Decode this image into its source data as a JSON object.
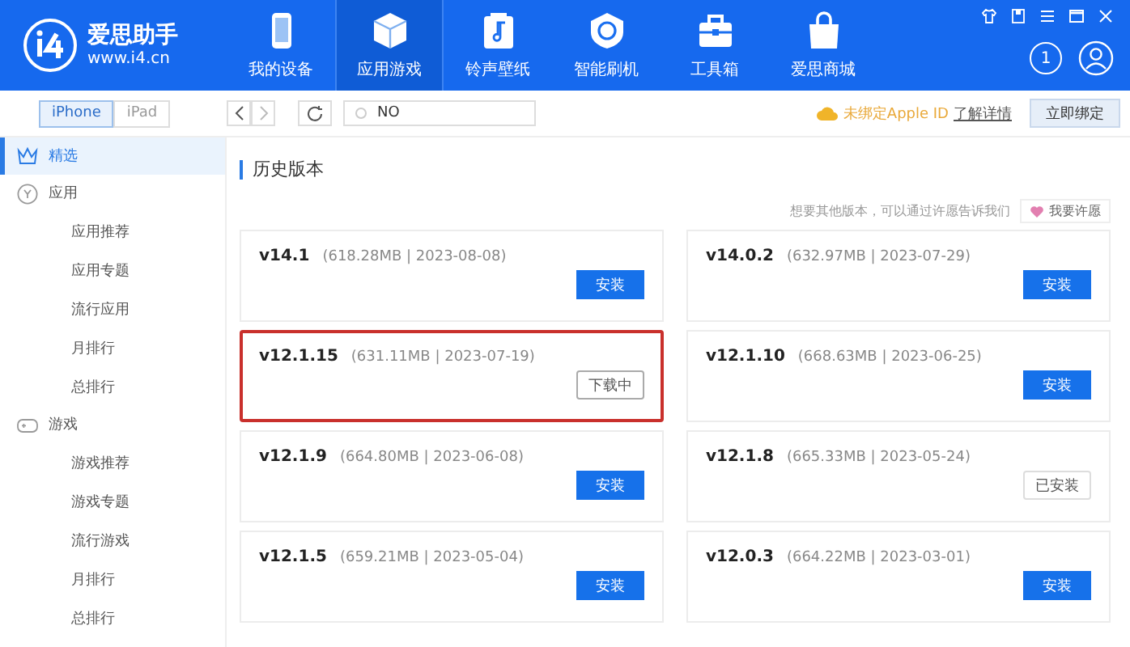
{
  "app": {
    "name": "爱思助手",
    "url": "www.i4.cn"
  },
  "nav": [
    {
      "label": "我的设备",
      "selected": false
    },
    {
      "label": "应用游戏",
      "selected": true
    },
    {
      "label": "铃声壁纸",
      "selected": false
    },
    {
      "label": "智能刷机",
      "selected": false
    },
    {
      "label": "工具箱",
      "selected": false
    },
    {
      "label": "爱思商城",
      "selected": false
    }
  ],
  "notification_count": "1",
  "device_tabs": [
    {
      "label": "iPhone",
      "selected": true
    },
    {
      "label": "iPad",
      "selected": false
    }
  ],
  "search": {
    "value": "NO"
  },
  "apple_id": {
    "status": "未绑定Apple ID",
    "link": "了解详情",
    "button": "立即绑定"
  },
  "sidebar": [
    {
      "label": "精选",
      "selected": true
    },
    {
      "label": "应用",
      "selected": false,
      "children": [
        {
          "label": "应用推荐",
          "selected": false
        },
        {
          "label": "应用专题",
          "selected": false
        },
        {
          "label": "流行应用",
          "selected": false
        },
        {
          "label": "月排行",
          "selected": false
        },
        {
          "label": "总排行",
          "selected": false
        }
      ]
    },
    {
      "label": "游戏",
      "selected": false,
      "children": [
        {
          "label": "游戏推荐",
          "selected": false
        },
        {
          "label": "游戏专题",
          "selected": false
        },
        {
          "label": "流行游戏",
          "selected": false
        },
        {
          "label": "月排行",
          "selected": false
        },
        {
          "label": "总排行",
          "selected": false
        }
      ]
    }
  ],
  "section_title": "历史版本",
  "wish": {
    "hint": "想要其他版本，可以通过许愿告诉我们",
    "button": "我要许愿"
  },
  "versions": [
    {
      "version": "v14.1",
      "info": "(618.28MB | 2023-08-08)",
      "action": "安装",
      "kind": "install",
      "highlighted": false
    },
    {
      "version": "v14.0.2",
      "info": "(632.97MB | 2023-07-29)",
      "action": "安装",
      "kind": "install",
      "highlighted": false
    },
    {
      "version": "v12.1.15",
      "info": "(631.11MB | 2023-07-19)",
      "action": "下载中",
      "kind": "downloading",
      "highlighted": true
    },
    {
      "version": "v12.1.10",
      "info": "(668.63MB | 2023-06-25)",
      "action": "安装",
      "kind": "install",
      "highlighted": false
    },
    {
      "version": "v12.1.9",
      "info": "(664.80MB | 2023-06-08)",
      "action": "安装",
      "kind": "install",
      "highlighted": false
    },
    {
      "version": "v12.1.8",
      "info": "(665.33MB | 2023-05-24)",
      "action": "已安装",
      "kind": "installed",
      "highlighted": false
    },
    {
      "version": "v12.1.5",
      "info": "(659.21MB | 2023-05-04)",
      "action": "安装",
      "kind": "install",
      "highlighted": false
    },
    {
      "version": "v12.0.3",
      "info": "(664.22MB | 2023-03-01)",
      "action": "安装",
      "kind": "install",
      "highlighted": false
    }
  ]
}
